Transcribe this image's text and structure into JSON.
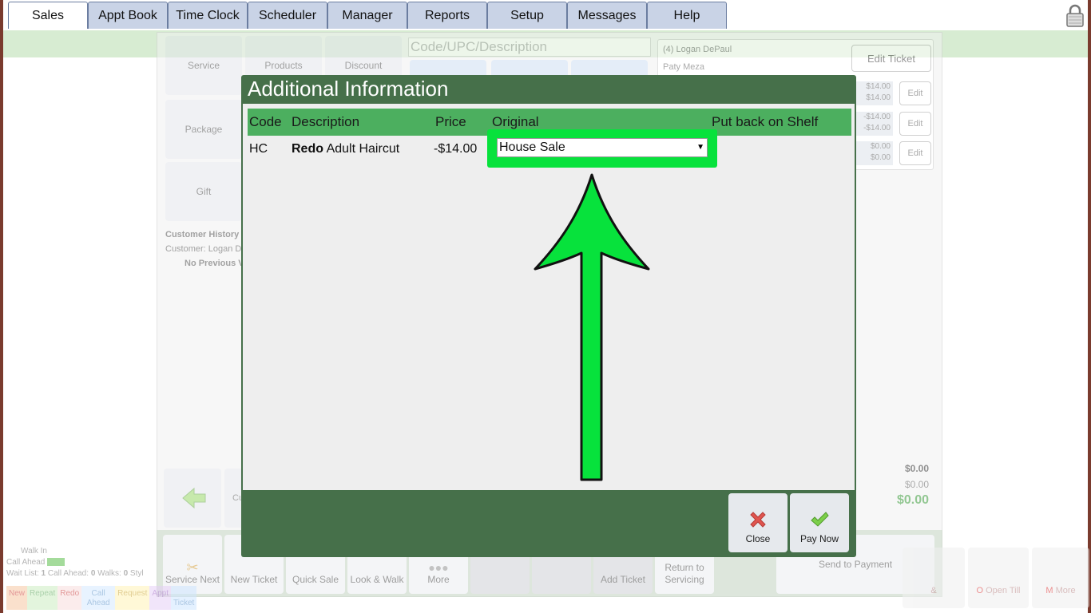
{
  "nav": {
    "tabs": [
      "Sales",
      "Appt Book",
      "Time Clock",
      "Scheduler",
      "Manager",
      "Reports",
      "Setup",
      "Messages",
      "Help"
    ],
    "active_tab": "Sales"
  },
  "categories": {
    "service": "Service",
    "products": "Products",
    "discount": "Discount",
    "package": "Package",
    "gift": "Gift"
  },
  "search": {
    "placeholder": "Code/UPC/Description"
  },
  "customer_history": {
    "title": "Customer History",
    "customer": "Customer: Logan D",
    "no_previous": "No Previous V"
  },
  "ticket": {
    "customer_line": "(4) Logan DePaul",
    "stylist": "Paty Meza",
    "edit_ticket_label": "Edit Ticket",
    "lines": [
      {
        "a": "$14.00",
        "b": "$14.00",
        "edit": "Edit"
      },
      {
        "a": "-$14.00",
        "b": "-$14.00",
        "edit": "Edit"
      },
      {
        "a": "$0.00",
        "b": "$0.00",
        "edit": "Edit"
      }
    ],
    "subtotal": "$0.00",
    "tax": "$0.00",
    "total": "$0.00"
  },
  "left_nav": {
    "cu_label": "Cu"
  },
  "toolbar": {
    "service_next": "Service Next",
    "new_ticket": "New Ticket",
    "quick_sale": "Quick Sale",
    "look_walk": "Look & Walk",
    "more": "More",
    "add_ticket": "Add Ticket",
    "return_servicing": "Return to Servicing",
    "send_payment": "Send to Payment"
  },
  "wait": {
    "walk_in": "Walk In",
    "call_ahead": "Call Ahead",
    "wait_list_label": "Wait List:",
    "wait_list_value": "1",
    "call_ahead_label": "Call Ahead:",
    "call_ahead_value": "0",
    "walks_label": "Walks:",
    "walks_value": "0",
    "style_label": "Styl",
    "tags": [
      "New",
      "Repeat",
      "Redo",
      "Call Ahead",
      "Request",
      "Appt",
      "Ticket"
    ]
  },
  "right_tiles": {
    "partial": "&",
    "open_till": "Open Till",
    "open_till_key": "O",
    "more": "More",
    "more_key": "M"
  },
  "modal": {
    "title": "Additional Information",
    "columns": {
      "code": "Code",
      "description": "Description",
      "price": "Price",
      "original": "Original",
      "shelf": "Put back on Shelf"
    },
    "row": {
      "code": "HC",
      "desc_bold": "Redo",
      "desc_rest": "Adult Haircut",
      "price": "-$14.00",
      "original_selected": "House Sale"
    },
    "close_label": "Close",
    "pay_now_label": "Pay Now"
  },
  "colors": {
    "modal_green": "#46704a",
    "header_green": "#4caf5f",
    "highlight": "#07e23c"
  }
}
